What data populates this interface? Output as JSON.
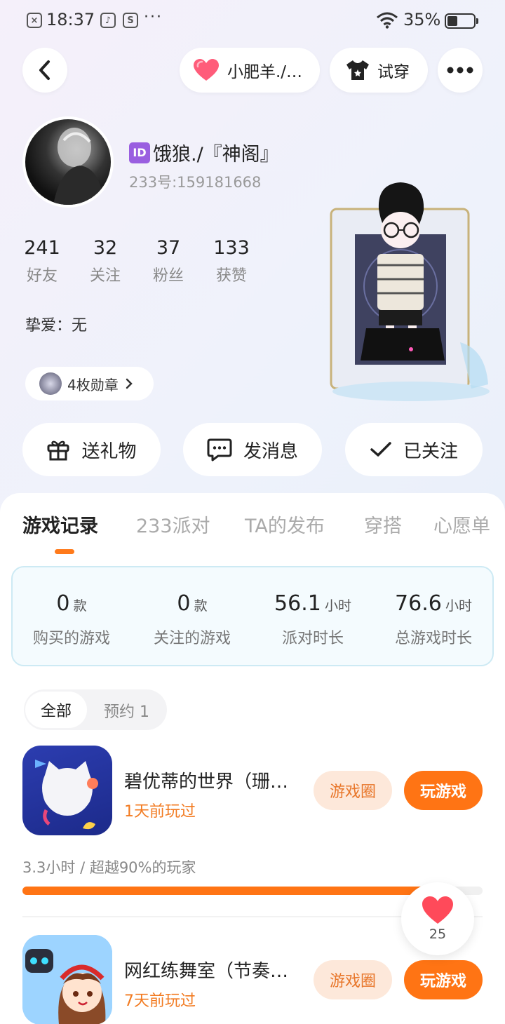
{
  "status_bar": {
    "time": "18:37",
    "battery": "35%"
  },
  "top_bar": {
    "couple_label": "小肥羊./…",
    "try_on_label": "试穿"
  },
  "profile": {
    "username": "饿狼./『神阁』",
    "id_badge": "ID",
    "uid": "233号:159181668",
    "stats": [
      {
        "num": "241",
        "label": "好友"
      },
      {
        "num": "32",
        "label": "关注"
      },
      {
        "num": "37",
        "label": "粉丝"
      },
      {
        "num": "133",
        "label": "获赞"
      }
    ],
    "bestie": "挚爱：无",
    "medals": "4枚勋章"
  },
  "actions": {
    "gift": "送礼物",
    "message": "发消息",
    "followed": "已关注"
  },
  "tabs": [
    "游戏记录",
    "233派对",
    "TA的发布",
    "穿搭",
    "心愿单"
  ],
  "summary": [
    {
      "num": "0",
      "unit": "款",
      "label": "购买的游戏"
    },
    {
      "num": "0",
      "unit": "款",
      "label": "关注的游戏"
    },
    {
      "num": "56.1",
      "unit": "小时",
      "label": "派对时长"
    },
    {
      "num": "76.6",
      "unit": "小时",
      "label": "总游戏时长"
    }
  ],
  "filters": {
    "all": "全部",
    "booked": "预约 1"
  },
  "games": [
    {
      "title": "碧优蒂的世界（珊…",
      "last_played": "1天前玩过",
      "circle": "游戏圈",
      "play": "玩游戏",
      "playtime": "3.3小时 / 超越90%的玩家",
      "progress": 0.9
    },
    {
      "title": "网红练舞室（节奏…",
      "last_played": "7天前玩过",
      "circle": "游戏圈",
      "play": "玩游戏"
    }
  ],
  "like_count": "25",
  "colors": {
    "accent": "#ff7414",
    "heart": "#ff4a5a"
  }
}
